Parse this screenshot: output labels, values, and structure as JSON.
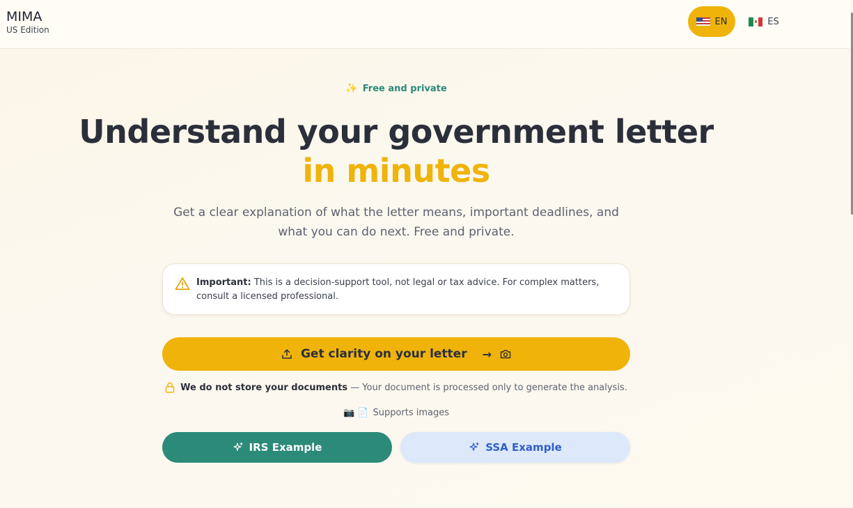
{
  "header": {
    "brand_title": "MIMA",
    "brand_subtitle": "US Edition",
    "languages": [
      {
        "code": "EN",
        "flag": "us-flag-icon",
        "selected": true
      },
      {
        "code": "ES",
        "flag": "mexico-flag-icon",
        "selected": false
      }
    ]
  },
  "hero": {
    "tagline_icon": "✨",
    "tagline": "Free and private",
    "headline": "Understand your government letter",
    "headline_accent": "in minutes",
    "subtitle": "Get a clear explanation of what the letter means, important deadlines, and what you can do next. Free and private."
  },
  "disclaimer": {
    "label": "Important:",
    "text": " This is a decision-support tool, not legal or tax advice. For complex matters, consult a licensed professional."
  },
  "cta": {
    "label": "Get clarity on your letter",
    "arrow": "→"
  },
  "privacy": {
    "bold": "We do not store your documents",
    "text": " — Your document is processed only to generate the analysis."
  },
  "supports": {
    "icons": "📷 📄",
    "text": "Supports images"
  },
  "examples": {
    "irs_label": "IRS Example",
    "ssa_label": "SSA Example"
  },
  "colors": {
    "accent": "#efb30a",
    "teal": "#2b8a78",
    "ssa_bg": "#dde9fb",
    "ssa_text": "#2f5fc6",
    "heading": "#2b2f3a"
  }
}
